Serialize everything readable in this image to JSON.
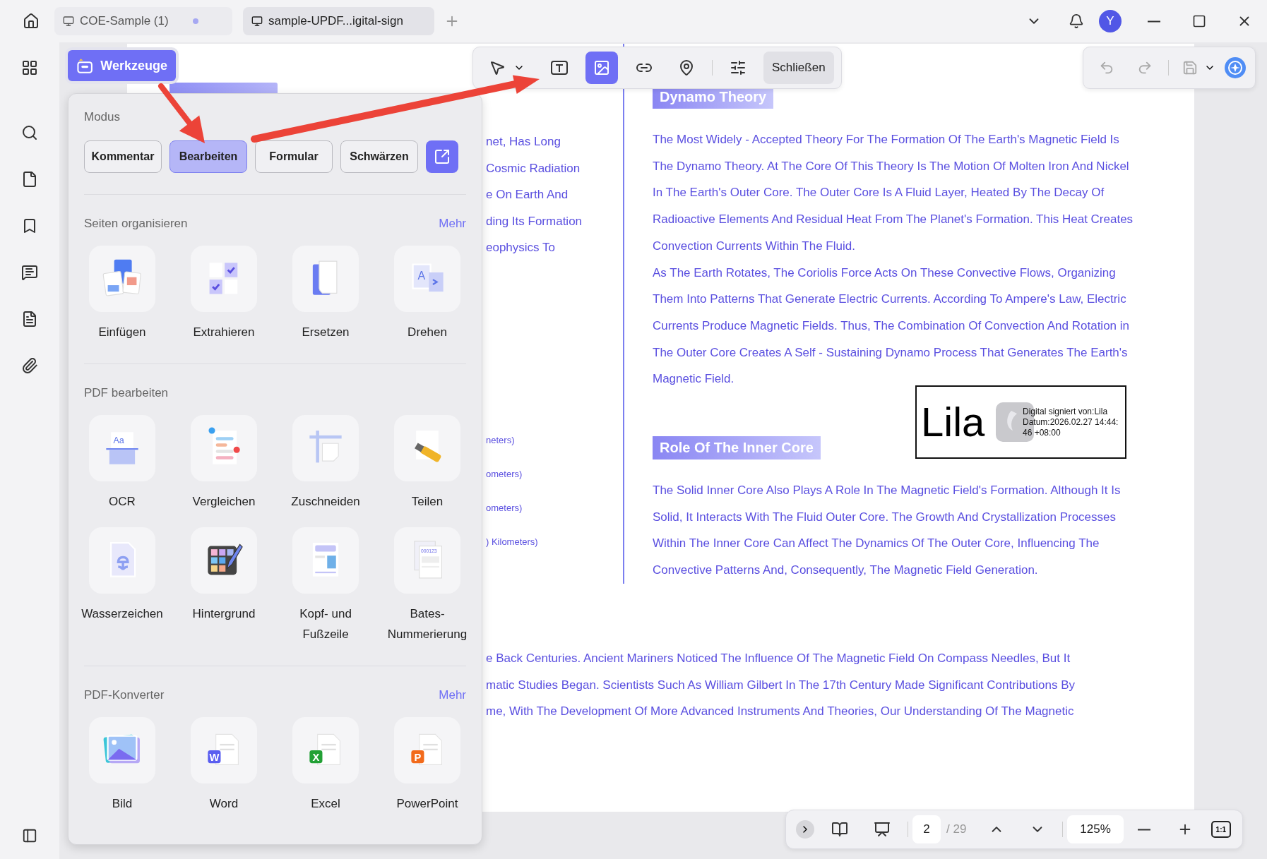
{
  "tabs": [
    {
      "label": "COE-Sample (1)",
      "selected": false,
      "modified": true
    },
    {
      "label": "sample-UPDF...igital-sign",
      "selected": true,
      "modified": false
    }
  ],
  "user": {
    "initial": "Y"
  },
  "tools_button": {
    "label": "Werkzeuge"
  },
  "toolbar": {
    "tools": [
      {
        "kind": "pointer",
        "selected": false
      },
      {
        "kind": "textbox",
        "selected": false
      },
      {
        "kind": "image",
        "selected": true
      },
      {
        "kind": "link",
        "selected": false
      },
      {
        "kind": "location",
        "selected": false
      }
    ],
    "close_label": "Schließen"
  },
  "tools_panel": {
    "mode_title": "Modus",
    "modes": [
      {
        "label": "Kommentar",
        "selected": false
      },
      {
        "label": "Bearbeiten",
        "selected": true
      },
      {
        "label": "Formular",
        "selected": false
      },
      {
        "label": "Schwärzen",
        "selected": false
      }
    ],
    "sections": [
      {
        "title": "Seiten organisieren",
        "more": "Mehr",
        "tools": [
          {
            "kind": "insert",
            "label": "Einfügen"
          },
          {
            "kind": "extract",
            "label": "Extrahieren"
          },
          {
            "kind": "replace",
            "label": "Ersetzen"
          },
          {
            "kind": "rotate",
            "label": "Drehen",
            "badge": "A"
          }
        ]
      },
      {
        "title": "PDF bearbeiten",
        "tools": [
          {
            "kind": "ocr",
            "label": "OCR",
            "badge": "Aa"
          },
          {
            "kind": "compare",
            "label": "Vergleichen"
          },
          {
            "kind": "crop",
            "label": "Zuschneiden"
          },
          {
            "kind": "split",
            "label": "Teilen"
          },
          {
            "kind": "watermark",
            "label": "Wasserzeichen"
          },
          {
            "kind": "background",
            "label": "Hintergrund"
          },
          {
            "kind": "header",
            "label": "Kopf- und Fußzeile"
          },
          {
            "kind": "bates",
            "label": "Bates-Nummerierung",
            "badge": "000123"
          }
        ]
      },
      {
        "title": "PDF-Konverter",
        "more": "Mehr",
        "tools": [
          {
            "kind": "image",
            "label": "Bild"
          },
          {
            "kind": "word",
            "label": "Word",
            "badge": "W"
          },
          {
            "kind": "excel",
            "label": "Excel",
            "badge": "X"
          },
          {
            "kind": "powerpoint",
            "label": "PowerPoint",
            "badge": "P"
          }
        ]
      }
    ]
  },
  "document": {
    "left_lines": [
      "net, Has Long",
      "Cosmic Radiation",
      "e On Earth And",
      "ding Its Formation",
      "eophysics To"
    ],
    "left_small_lines": [
      "neters)",
      "ometers)",
      "ometers)",
      ") Kilometers)"
    ],
    "sections": [
      {
        "heading": "Dynamo Theory",
        "paragraphs": [
          [
            "The Most Widely - Accepted Theory For The Formation Of The Earth's Magnetic Field Is",
            "The Dynamo Theory. At The Core Of This Theory Is The Motion Of Molten Iron And Nickel",
            "In The Earth's Outer Core. The Outer Core Is A Fluid Layer, Heated By The Decay Of",
            "Radioactive Elements And Residual Heat From The Planet's Formation. This Heat Creates",
            "Convection Currents Within The Fluid."
          ],
          [
            "As The Earth Rotates, The Coriolis Force Acts On These Convective Flows, Organizing",
            "Them Into Patterns That Generate Electric Currents. According To Ampere's Law, Electric",
            "Currents Produce Magnetic Fields. Thus, The Combination Of Convection And Rotation in",
            "The Outer Core Creates A Self - Sustaining Dynamo Process That Generates The Earth's",
            "Magnetic Field."
          ]
        ]
      },
      {
        "heading": "Role Of The Inner Core",
        "paragraphs": [
          [
            "The Solid Inner Core Also Plays A Role In The Magnetic Field's Formation. Although It Is",
            "Solid, It Interacts With The Fluid Outer Core. The Growth And Crystallization Processes",
            "Within The Inner Core Can Affect The Dynamics Of The Outer Core, Influencing The",
            "Convective Patterns And, Consequently, The Magnetic Field Generation."
          ]
        ]
      }
    ],
    "signature": {
      "name": "Lila",
      "details": [
        "Digital signiert von:Lila",
        "Datum:2026.02.27 14:44:",
        "46 +08:00"
      ]
    },
    "bottom_lines": [
      "e Back Centuries. Ancient Mariners Noticed The Influence Of The Magnetic Field On Compass Needles, But It",
      "matic Studies Began. Scientists Such As William Gilbert In The 17th Century Made Significant Contributions By",
      "me, With The Development Of More Advanced Instruments And Theories, Our Understanding Of The Magnetic"
    ]
  },
  "page_nav": {
    "page": "2",
    "total": "/ 29",
    "zoom": "125%",
    "actual_size": "1:1"
  }
}
